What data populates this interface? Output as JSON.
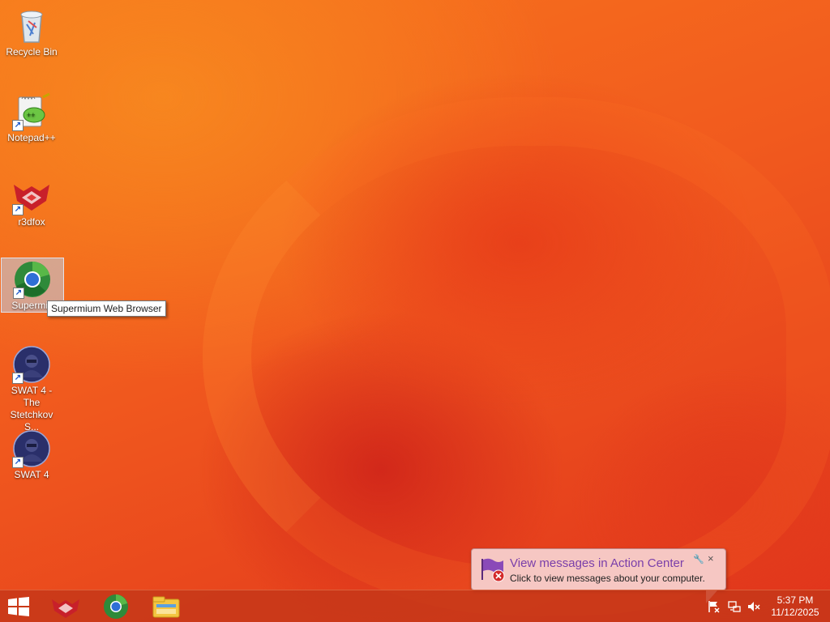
{
  "desktop": {
    "icons": [
      {
        "label": "Recycle Bin",
        "icon": "recycle-bin-icon"
      },
      {
        "label": "Notepad++",
        "icon": "notepad-plus-plus-icon"
      },
      {
        "label": "r3dfox",
        "icon": "r3dfox-icon"
      },
      {
        "label": "Supermium Web Browser",
        "icon": "supermium-icon"
      },
      {
        "label": "SWAT 4 - The Stetchkov S...",
        "icon": "swat4-icon"
      },
      {
        "label": "SWAT 4",
        "icon": "swat4-icon"
      }
    ],
    "selected_icon_label": "Supermiu",
    "tooltip": "Supermium Web Browser"
  },
  "notification": {
    "title": "View messages in Action Center",
    "message": "Click to view messages about your computer.",
    "close_glyph": "×",
    "pin_glyph": "🔧"
  },
  "taskbar": {
    "pinned_apps": [
      "r3dfox-icon",
      "supermium-icon",
      "file-explorer-icon"
    ],
    "tray": [
      "action-center-flag-icon",
      "network-icon",
      "volume-muted-icon"
    ],
    "time": "5:37 PM",
    "date": "11/12/2025"
  },
  "colors": {
    "wallpaper_accent": "#f15a1e",
    "taskbar": "#c43719",
    "balloon_bg": "#f6c7c3",
    "balloon_title": "#7a3faa"
  }
}
